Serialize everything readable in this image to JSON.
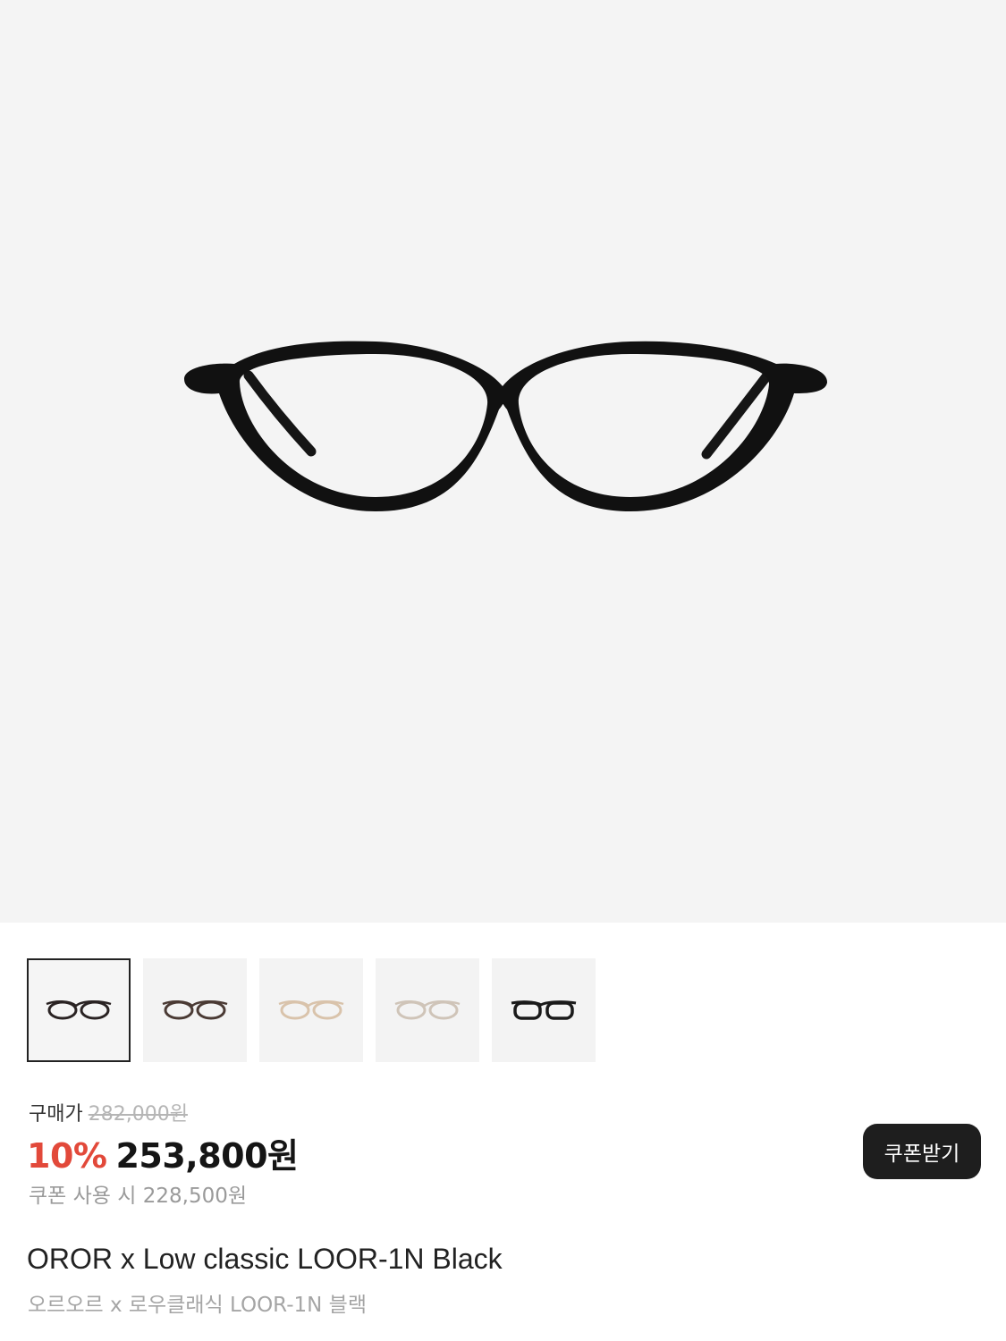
{
  "product": {
    "images": {
      "main_alt": "black oval glasses",
      "thumbnails": [
        {
          "name": "black",
          "color": "#2a2323",
          "active": true
        },
        {
          "name": "brown",
          "color": "#4a3a34",
          "active": false
        },
        {
          "name": "beige",
          "color": "#d9c3ab",
          "active": false
        },
        {
          "name": "clear",
          "color": "#cfc4b8",
          "active": false
        },
        {
          "name": "black-bold",
          "color": "#1a1a1a",
          "active": false
        }
      ]
    },
    "price": {
      "label": "구매가",
      "original": "282,000원",
      "discount": "10%",
      "final": "253,800원",
      "coupon_text": "쿠폰 사용 시 228,500원"
    },
    "coupon_button": "쿠폰받기",
    "title_en": "OROR x Low classic LOOR-1N Black",
    "title_ko": "오르오르 x 로우클래식 LOOR-1N 블랙",
    "colors": {
      "discount": "#e2493a",
      "button_bg": "#1e1e1e",
      "hero_bg": "#f4f4f4"
    }
  }
}
